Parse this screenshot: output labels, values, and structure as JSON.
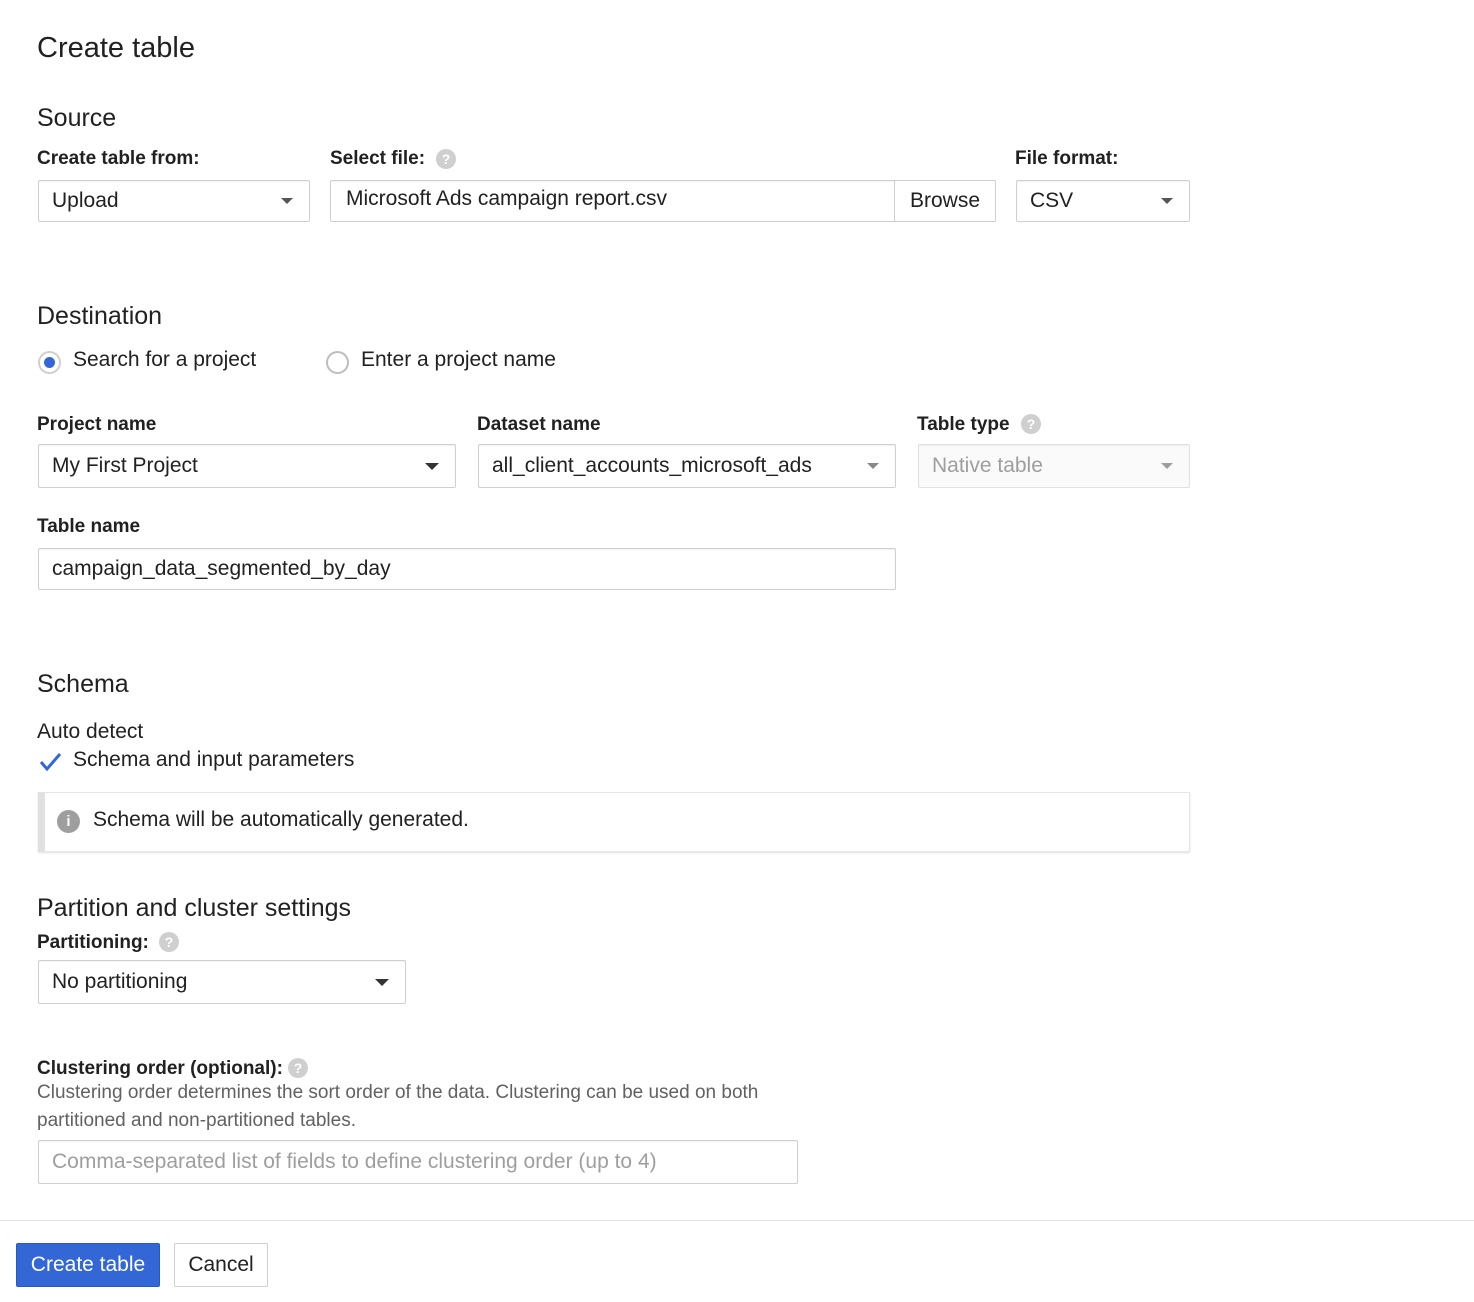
{
  "page_title": "Create table",
  "source": {
    "heading": "Source",
    "create_from_label": "Create table from:",
    "create_from_value": "Upload",
    "select_file_label": "Select file:",
    "file_value": "Microsoft Ads campaign report.csv",
    "browse_label": "Browse",
    "file_format_label": "File format:",
    "file_format_value": "CSV"
  },
  "destination": {
    "heading": "Destination",
    "radio_search": "Search for a project",
    "radio_enter": "Enter a project name",
    "selected_option": "Search for a project",
    "project_label": "Project name",
    "project_value": "My First Project",
    "dataset_label": "Dataset name",
    "dataset_value": "all_client_accounts_microsoft_ads",
    "table_type_label": "Table type",
    "table_type_value": "Native table",
    "table_name_label": "Table name",
    "table_name_value": "campaign_data_segmented_by_day"
  },
  "schema": {
    "heading": "Schema",
    "auto_detect_label": "Auto detect",
    "checkbox_label": "Schema and input parameters",
    "checkbox_checked": true,
    "info_text": "Schema will be automatically generated."
  },
  "partition": {
    "heading": "Partition and cluster settings",
    "partitioning_label": "Partitioning:",
    "partitioning_value": "No partitioning",
    "clustering_label": "Clustering order (optional):",
    "clustering_desc_line1": "Clustering order determines the sort order of the data. Clustering can be used on both",
    "clustering_desc_line2": "partitioned and non-partitioned tables.",
    "clustering_placeholder": "Comma-separated list of fields to define clustering order (up to 4)"
  },
  "footer": {
    "create_button": "Create table",
    "cancel_button": "Cancel"
  },
  "colors": {
    "accent": "#3367d6",
    "help_icon": "#cfcfcf"
  }
}
